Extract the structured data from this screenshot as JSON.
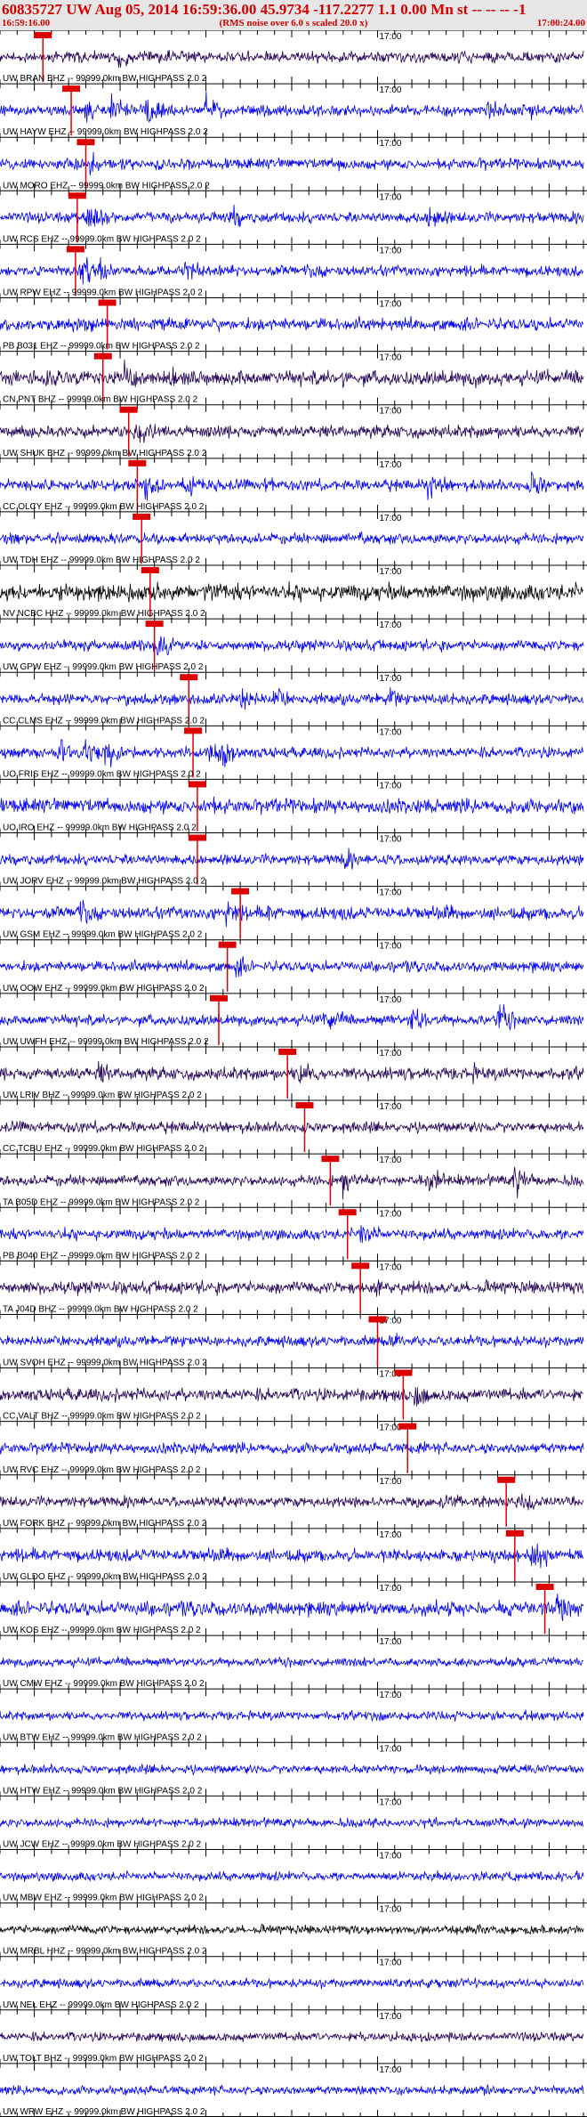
{
  "header": {
    "title": "60835727 UW Aug 05, 2014 16:59:36.00   45.9734 -117.2277  1.1 0.00 Mn st -- -- --  -1",
    "start_time": "16:59:16.00",
    "note": "(RMS noise over 6.0 s scaled 20.0 x)",
    "end_time": "17:00:24.00"
  },
  "chart_data": {
    "type": "line",
    "title": "60835727 UW Aug 05, 2014 16:59:36.00   45.9734 -117.2277  1.1 0.00 Mn st -- -- --  -1",
    "x_start": "16:59:16.00",
    "x_end": "17:00:24.00",
    "x_range_seconds": [
      0,
      68
    ],
    "minute_tick_label": "17:00",
    "minute_tick_second": 44,
    "colors": {
      "blue": "#0000ee",
      "navy": "#220055",
      "black": "#000000",
      "pick": "#dd0000",
      "grid": "#000000"
    },
    "traces": [
      {
        "label": "UW BRAN BHZ -- 99999.0km BW  HIGHPASS  2.0  2",
        "color": "navy",
        "pick_s": 5.0,
        "amp": 0.3,
        "events": [
          [
            13.8,
            0.7
          ],
          [
            18.3,
            0.5
          ],
          [
            29,
            0.3
          ],
          [
            41,
            0.4
          ],
          [
            57,
            0.5
          ]
        ]
      },
      {
        "label": "UW HAYW EHZ -- 99999.0km BW  HIGHPASS  2.0  2",
        "color": "blue",
        "pick_s": 8.3,
        "amp": 0.3,
        "events": [
          [
            9.5,
            1.0
          ],
          [
            13,
            1.0
          ],
          [
            17,
            1.0
          ],
          [
            24,
            0.9
          ],
          [
            57,
            0.9
          ],
          [
            62,
            0.6
          ]
        ]
      },
      {
        "label": "UW MORO EHZ -- 99999.0km BW  HIGHPASS  2.0  2",
        "color": "blue",
        "pick_s": 10.0,
        "amp": 0.3,
        "events": [
          [
            10.5,
            0.7
          ],
          [
            18,
            0.4
          ],
          [
            39.5,
            0.5
          ],
          [
            56,
            0.4
          ]
        ]
      },
      {
        "label": "UW RCS EHZ -- 99999.0km BW  HIGHPASS  2.0  2",
        "color": "blue",
        "pick_s": 9.0,
        "amp": 0.3,
        "events": [
          [
            10,
            1.0
          ],
          [
            27,
            0.8
          ],
          [
            50,
            1.0
          ]
        ]
      },
      {
        "label": "UW RPW EHZ -- 99999.0km BW  HIGHPASS  2.0  2",
        "color": "blue",
        "pick_s": 8.8,
        "amp": 0.3,
        "events": [
          [
            9.5,
            1.0
          ],
          [
            11.5,
            0.8
          ],
          [
            21.5,
            0.9
          ],
          [
            27,
            0.5
          ]
        ]
      },
      {
        "label": "PB B031 EHZ -- 99999.0km BW  HIGHPASS  2.0  2",
        "color": "blue",
        "pick_s": 12.5,
        "amp": 0.35,
        "events": [
          [
            13.5,
            0.6
          ]
        ]
      },
      {
        "label": "CN PNT BHZ -- 99999.0km BW  HIGHPASS  2.0  2",
        "color": "navy",
        "pick_s": 12.0,
        "amp": 0.4,
        "events": [
          [
            14.5,
            1.0
          ],
          [
            19.5,
            0.7
          ],
          [
            28,
            0.6
          ],
          [
            40,
            0.6
          ],
          [
            55,
            0.6
          ]
        ]
      },
      {
        "label": "UW SHUK BHZ -- 99999.0km BW  HIGHPASS  2.0  2",
        "color": "navy",
        "pick_s": 15.0,
        "amp": 0.35,
        "events": [
          [
            15.8,
            0.8
          ]
        ]
      },
      {
        "label": "CC OLCY EHZ -- 99999.0km BW  HIGHPASS  2.0  2",
        "color": "blue",
        "pick_s": 16.0,
        "amp": 0.3,
        "events": [
          [
            17,
            1.0
          ],
          [
            21.5,
            1.0
          ],
          [
            31,
            0.6
          ],
          [
            50,
            1.0
          ],
          [
            62,
            1.0
          ]
        ]
      },
      {
        "label": "UW TDH EHZ -- 99999.0km BW  HIGHPASS  2.0  2",
        "color": "blue",
        "pick_s": 16.5,
        "amp": 0.3,
        "events": [
          [
            18,
            0.5
          ],
          [
            42,
            0.4
          ]
        ]
      },
      {
        "label": "NV NCBC HHZ -- 99999.0km BW  HIGHPASS  2.0  2",
        "color": "black",
        "pick_s": 17.5,
        "amp": 0.45,
        "events": [
          [
            18,
            0.6
          ],
          [
            40,
            0.5
          ],
          [
            62,
            0.5
          ]
        ]
      },
      {
        "label": "UW GPW EHZ -- 99999.0km BW  HIGHPASS  2.0  2",
        "color": "blue",
        "pick_s": 18.0,
        "amp": 0.3,
        "events": [
          [
            18.5,
            1.0
          ]
        ]
      },
      {
        "label": "CC CLMS EHZ -- 99999.0km BW  HIGHPASS  2.0  2",
        "color": "blue",
        "pick_s": 22.0,
        "amp": 0.3,
        "events": [
          [
            28,
            1.0
          ],
          [
            32,
            0.8
          ],
          [
            45,
            0.8
          ],
          [
            52,
            0.6
          ]
        ]
      },
      {
        "label": "UO FRIS EHZ -- 99999.0km BW  HIGHPASS  2.0  2",
        "color": "blue",
        "pick_s": 22.5,
        "amp": 0.3,
        "events": [
          [
            7,
            1.0
          ],
          [
            10,
            1.0
          ],
          [
            12,
            1.0
          ],
          [
            24.5,
            1.0
          ],
          [
            26,
            1.0
          ]
        ]
      },
      {
        "label": "UO IRO EHZ -- 99999.0km BW  HIGHPASS  2.0  2",
        "color": "blue",
        "pick_s": 23.0,
        "amp": 0.4,
        "events": [
          [
            24,
            0.8
          ]
        ]
      },
      {
        "label": "UW JORV EHZ -- 99999.0km BW  HIGHPASS  2.0  2",
        "color": "blue",
        "pick_s": 23.0,
        "amp": 0.3,
        "events": [
          [
            40,
            0.7
          ],
          [
            45,
            0.5
          ]
        ]
      },
      {
        "label": "UW GSM EHZ -- 99999.0km BW  HIGHPASS  2.0  2",
        "color": "blue",
        "pick_s": 28.0,
        "amp": 0.35,
        "events": [
          [
            9,
            0.8
          ],
          [
            26.5,
            1.0
          ],
          [
            31,
            0.7
          ],
          [
            40,
            0.5
          ],
          [
            52,
            0.5
          ]
        ]
      },
      {
        "label": "UW OOW EHZ -- 99999.0km BW  HIGHPASS  2.0  2",
        "color": "blue",
        "pick_s": 26.5,
        "amp": 0.3,
        "events": [
          [
            27.5,
            0.7
          ]
        ]
      },
      {
        "label": "UW UWFH EHZ -- 99999.0km BW  HIGHPASS  2.0  2",
        "color": "blue",
        "pick_s": 25.5,
        "amp": 0.3,
        "events": [
          [
            38,
            1.0
          ],
          [
            48,
            1.0
          ],
          [
            58,
            1.0
          ]
        ]
      },
      {
        "label": "UW LRIV BHZ -- 99999.0km BW  HIGHPASS  2.0  2",
        "color": "navy",
        "pick_s": 33.5,
        "amp": 0.35,
        "events": [
          [
            11.5,
            0.8
          ],
          [
            35,
            1.0
          ],
          [
            55,
            0.6
          ]
        ]
      },
      {
        "label": "CC TCBU EHZ -- 99999.0km BW  HIGHPASS  2.0  2",
        "color": "navy",
        "pick_s": 35.5,
        "amp": 0.3,
        "events": [
          [
            37,
            0.3
          ]
        ]
      },
      {
        "label": "TA B05D EHZ -- 99999.0km BW  HIGHPASS  2.0  2",
        "color": "navy",
        "pick_s": 38.5,
        "amp": 0.3,
        "events": [
          [
            40,
            1.0
          ],
          [
            50,
            0.9
          ],
          [
            60,
            1.0
          ]
        ]
      },
      {
        "label": "PB B040 EHZ -- 99999.0km BW  HIGHPASS  2.0  2",
        "color": "blue",
        "pick_s": 40.5,
        "amp": 0.3,
        "events": [
          [
            42,
            1.0
          ]
        ]
      },
      {
        "label": "TA J04D BHZ -- 99999.0km BW  HIGHPASS  2.0  2",
        "color": "navy",
        "pick_s": 42.0,
        "amp": 0.35,
        "events": [
          [
            44,
            0.7
          ]
        ]
      },
      {
        "label": "UW SVOH EHZ -- 99999.0km BW  HIGHPASS  2.0  2",
        "color": "blue",
        "pick_s": 44.0,
        "amp": 0.3,
        "events": [
          [
            45.5,
            0.6
          ]
        ]
      },
      {
        "label": "CC VALT BHZ -- 99999.0km BW  HIGHPASS  2.0  2",
        "color": "navy",
        "pick_s": 47.0,
        "amp": 0.35,
        "events": [
          [
            48.5,
            0.9
          ]
        ]
      },
      {
        "label": "UW RVC EHZ -- 99999.0km BW  HIGHPASS  2.0  2",
        "color": "blue",
        "pick_s": 47.5,
        "amp": 0.3,
        "events": [
          [
            49,
            0.5
          ]
        ]
      },
      {
        "label": "UW FORK BHZ -- 99999.0km BW  HIGHPASS  2.0  2",
        "color": "navy",
        "pick_s": 59.0,
        "amp": 0.3,
        "events": [
          [
            56,
            0.5
          ],
          [
            61,
            0.7
          ]
        ]
      },
      {
        "label": "UW GLDO EHZ -- 99999.0km BW  HIGHPASS  2.0  2",
        "color": "blue",
        "pick_s": 60.0,
        "amp": 0.35,
        "events": [
          [
            62,
            1.0
          ]
        ]
      },
      {
        "label": "UW KOS EHZ -- 99999.0km BW  HIGHPASS  2.0  2",
        "color": "blue",
        "pick_s": 63.5,
        "amp": 0.4,
        "events": [
          [
            65,
            1.0
          ]
        ]
      },
      {
        "label": "UW CMW EHZ -- 99999.0km BW  HIGHPASS  2.0  2",
        "color": "blue",
        "pick_s": null,
        "amp": 0.25,
        "events": []
      },
      {
        "label": "UW BTW EHZ -- 99999.0km BW  HIGHPASS  2.0  2",
        "color": "blue",
        "pick_s": null,
        "amp": 0.25,
        "events": []
      },
      {
        "label": "UW HTW EHZ -- 99999.0km BW  HIGHPASS  2.0  2",
        "color": "blue",
        "pick_s": null,
        "amp": 0.25,
        "events": []
      },
      {
        "label": "UW JCW EHZ -- 99999.0km BW  HIGHPASS  2.0  2",
        "color": "blue",
        "pick_s": null,
        "amp": 0.25,
        "events": []
      },
      {
        "label": "UW MBW EHZ -- 99999.0km BW  HIGHPASS  2.0  2",
        "color": "blue",
        "pick_s": null,
        "amp": 0.25,
        "events": []
      },
      {
        "label": "UW MRBL HHZ -- 99999.0km BW  HIGHPASS  2.0  2",
        "color": "black",
        "pick_s": null,
        "amp": 0.25,
        "events": []
      },
      {
        "label": "UW NEL EHZ -- 99999.0km BW  HIGHPASS  2.0  2",
        "color": "blue",
        "pick_s": null,
        "amp": 0.25,
        "events": []
      },
      {
        "label": "UW TOLT BHZ -- 99999.0km BW  HIGHPASS  2.0  2",
        "color": "navy",
        "pick_s": null,
        "amp": 0.25,
        "events": []
      },
      {
        "label": "UW WRW EHZ -- 99999.0km BW  HIGHPASS  2.0  2",
        "color": "blue",
        "pick_s": null,
        "amp": 0.25,
        "events": []
      }
    ]
  }
}
